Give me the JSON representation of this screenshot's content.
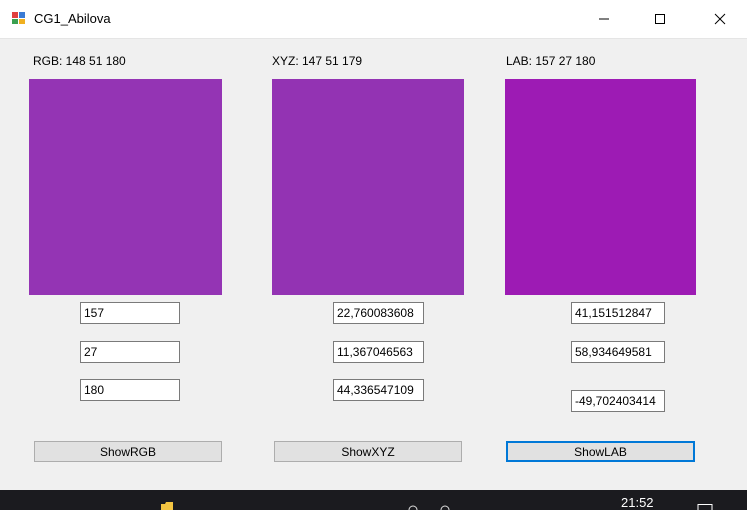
{
  "window": {
    "title": "CG1_Abilova"
  },
  "panels": {
    "rgb": {
      "label": "RGB: 148 51 180",
      "color": "#9434b4",
      "inputs": [
        "157",
        "27",
        "180"
      ],
      "button": "ShowRGB"
    },
    "xyz": {
      "label": "XYZ: 147 51 179",
      "color": "#9333b3",
      "inputs": [
        "22,760083608",
        "11,367046563",
        "44,336547109"
      ],
      "button": "ShowXYZ"
    },
    "lab": {
      "label": "LAB: 157 27 180",
      "color": "#9d1bb4",
      "inputs": [
        "41,151512847",
        "58,934649581",
        "-49,702403414"
      ],
      "button": "ShowLAB"
    }
  },
  "taskbar": {
    "clock": "21:52"
  }
}
